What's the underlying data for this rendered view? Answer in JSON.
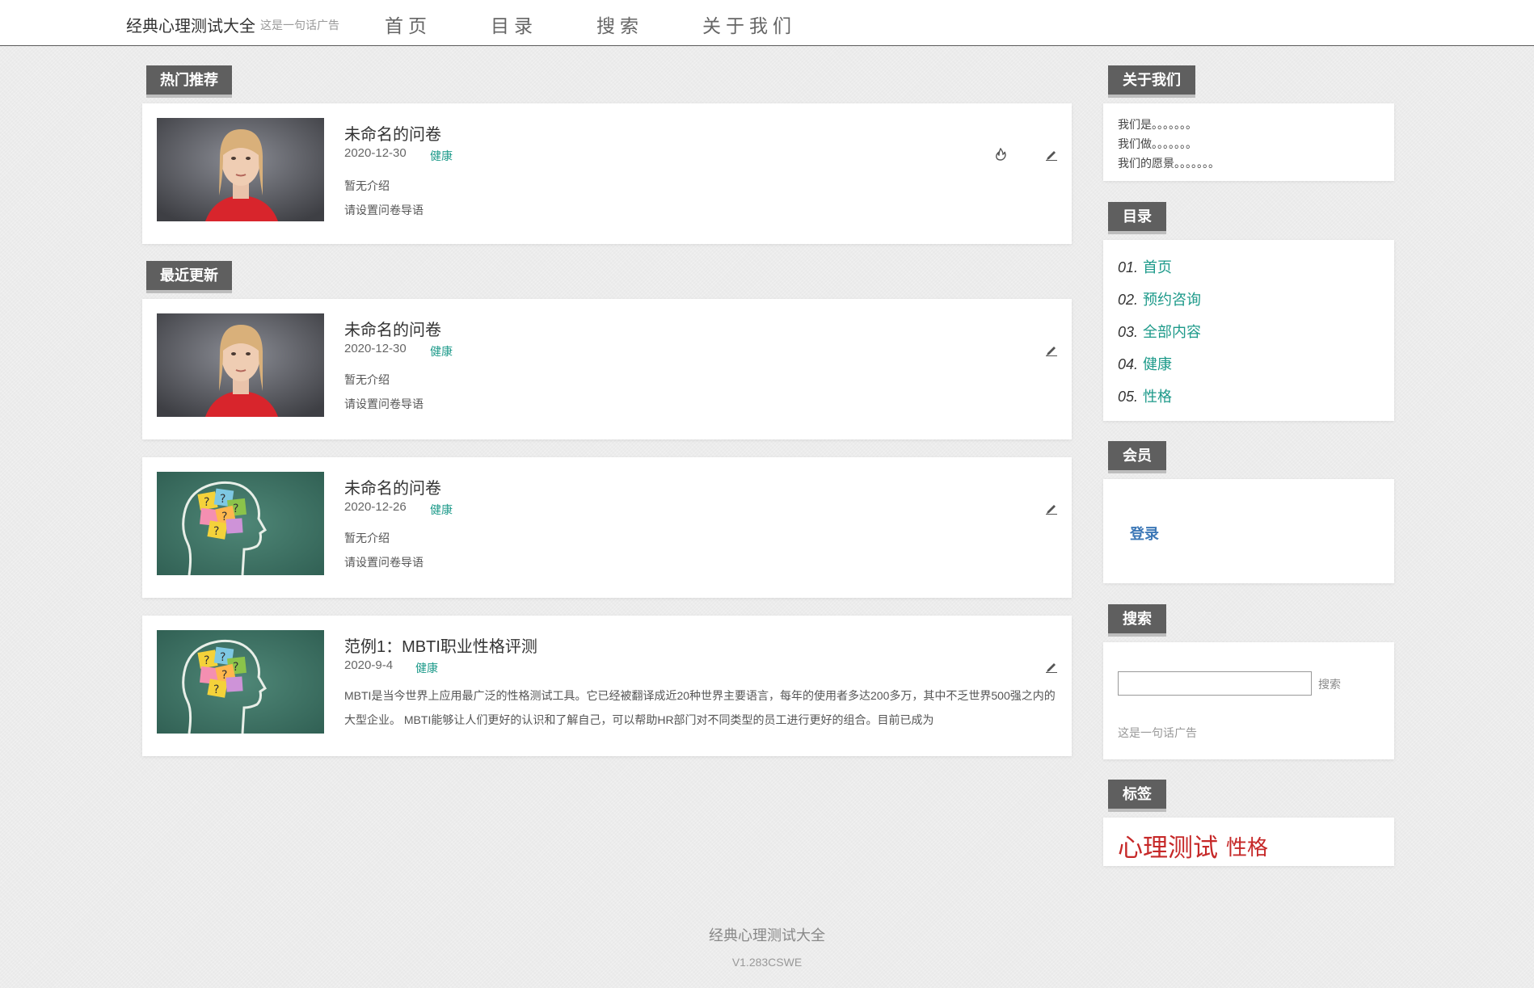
{
  "header": {
    "site_title": "经典心理测试大全",
    "site_ad": "这是一句话广告",
    "nav": [
      "首页",
      "目录",
      "搜索",
      "关于我们"
    ]
  },
  "main": {
    "hot_label": "热门推荐",
    "recent_label": "最近更新",
    "hot_post": {
      "title": "未命名的问卷",
      "date": "2020-12-30",
      "tag": "健康",
      "intro": "暂无介绍",
      "guide": "请设置问卷导语"
    },
    "recent_posts": [
      {
        "title": "未命名的问卷",
        "date": "2020-12-30",
        "tag": "健康",
        "intro": "暂无介绍",
        "guide": "请设置问卷导语",
        "image": "woman-portrait"
      },
      {
        "title": "未命名的问卷",
        "date": "2020-12-26",
        "tag": "健康",
        "intro": "暂无介绍",
        "guide": "请设置问卷导语",
        "image": "head-question-notes"
      },
      {
        "title": "范例1：MBTI职业性格评测",
        "date": "2020-9-4",
        "tag": "健康",
        "excerpt": "MBTI是当今世界上应用最广泛的性格测试工具。它已经被翻译成近20种世界主要语言，每年的使用者多达200多万，其中不乏世界500强之内的大型企业。 MBTI能够让人们更好的认识和了解自己，可以帮助HR部门对不同类型的员工进行更好的组合。目前已成为",
        "image": "head-question-notes"
      }
    ]
  },
  "sidebar": {
    "about": {
      "label": "关于我们",
      "lines": [
        "我们是。。。。。。。",
        "我们做。。。。。。。",
        "我们的愿景。。。。。。。"
      ]
    },
    "directory": {
      "label": "目录",
      "items": [
        {
          "num": "01.",
          "text": "首页"
        },
        {
          "num": "02.",
          "text": "预约咨询"
        },
        {
          "num": "03.",
          "text": "全部内容"
        },
        {
          "num": "04.",
          "text": "健康"
        },
        {
          "num": "05.",
          "text": "性格"
        }
      ]
    },
    "member": {
      "label": "会员",
      "login": "登录"
    },
    "search": {
      "label": "搜索",
      "button": "搜索",
      "ad": "这是一句话广告",
      "value": ""
    },
    "tags": {
      "label": "标签",
      "items": [
        "心理测试",
        "性格"
      ]
    }
  },
  "footer": {
    "title": "经典心理测试大全",
    "version": "V1.283CSWE"
  },
  "colors": {
    "accent": "#1d9a8a",
    "tag_red": "#c62828",
    "label_bg": "#5f5f5f",
    "link_blue": "#3d78b7"
  }
}
